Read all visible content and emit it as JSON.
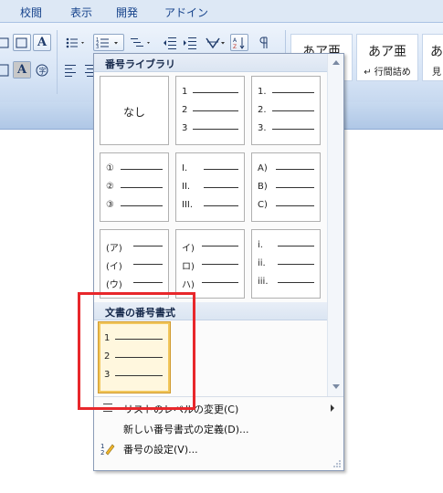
{
  "ribbon": {
    "tabs": [
      "校閲",
      "表示",
      "開発",
      "アドイン"
    ],
    "styles": [
      {
        "sample": "あア亜",
        "name": ""
      },
      {
        "sample": "あア亜",
        "name": "↵ 行間詰め"
      },
      {
        "sample": "あ",
        "name": "見"
      }
    ]
  },
  "dropdown": {
    "library_title": "番号ライブラリ",
    "none_label": "なし",
    "library_tiles": [
      [
        "1",
        "2",
        "3"
      ],
      [
        "1.",
        "2.",
        "3."
      ],
      [
        "①",
        "②",
        "③"
      ],
      [
        "I.",
        "II.",
        "III."
      ],
      [
        "A)",
        "B)",
        "C)"
      ],
      [
        "(ア)",
        "(イ)",
        "(ウ)"
      ],
      [
        "イ)",
        "ロ)",
        "ハ)"
      ],
      [
        "i.",
        "ii.",
        "iii."
      ]
    ],
    "document_title": "文書の番号書式",
    "document_tile": [
      "1",
      "2",
      "3"
    ],
    "menu": [
      {
        "label": "リストのレベルの変更(C)",
        "icon": "list-level-icon",
        "submenu": true
      },
      {
        "label": "新しい番号書式の定義(D)...",
        "icon": "",
        "submenu": false
      },
      {
        "label": "番号の設定(V)...",
        "icon": "number-value-icon",
        "submenu": false
      }
    ]
  },
  "colors": {
    "highlight": "#e8272b",
    "ribbon_text": "#15428b",
    "selected_border": "#d09a2e"
  }
}
